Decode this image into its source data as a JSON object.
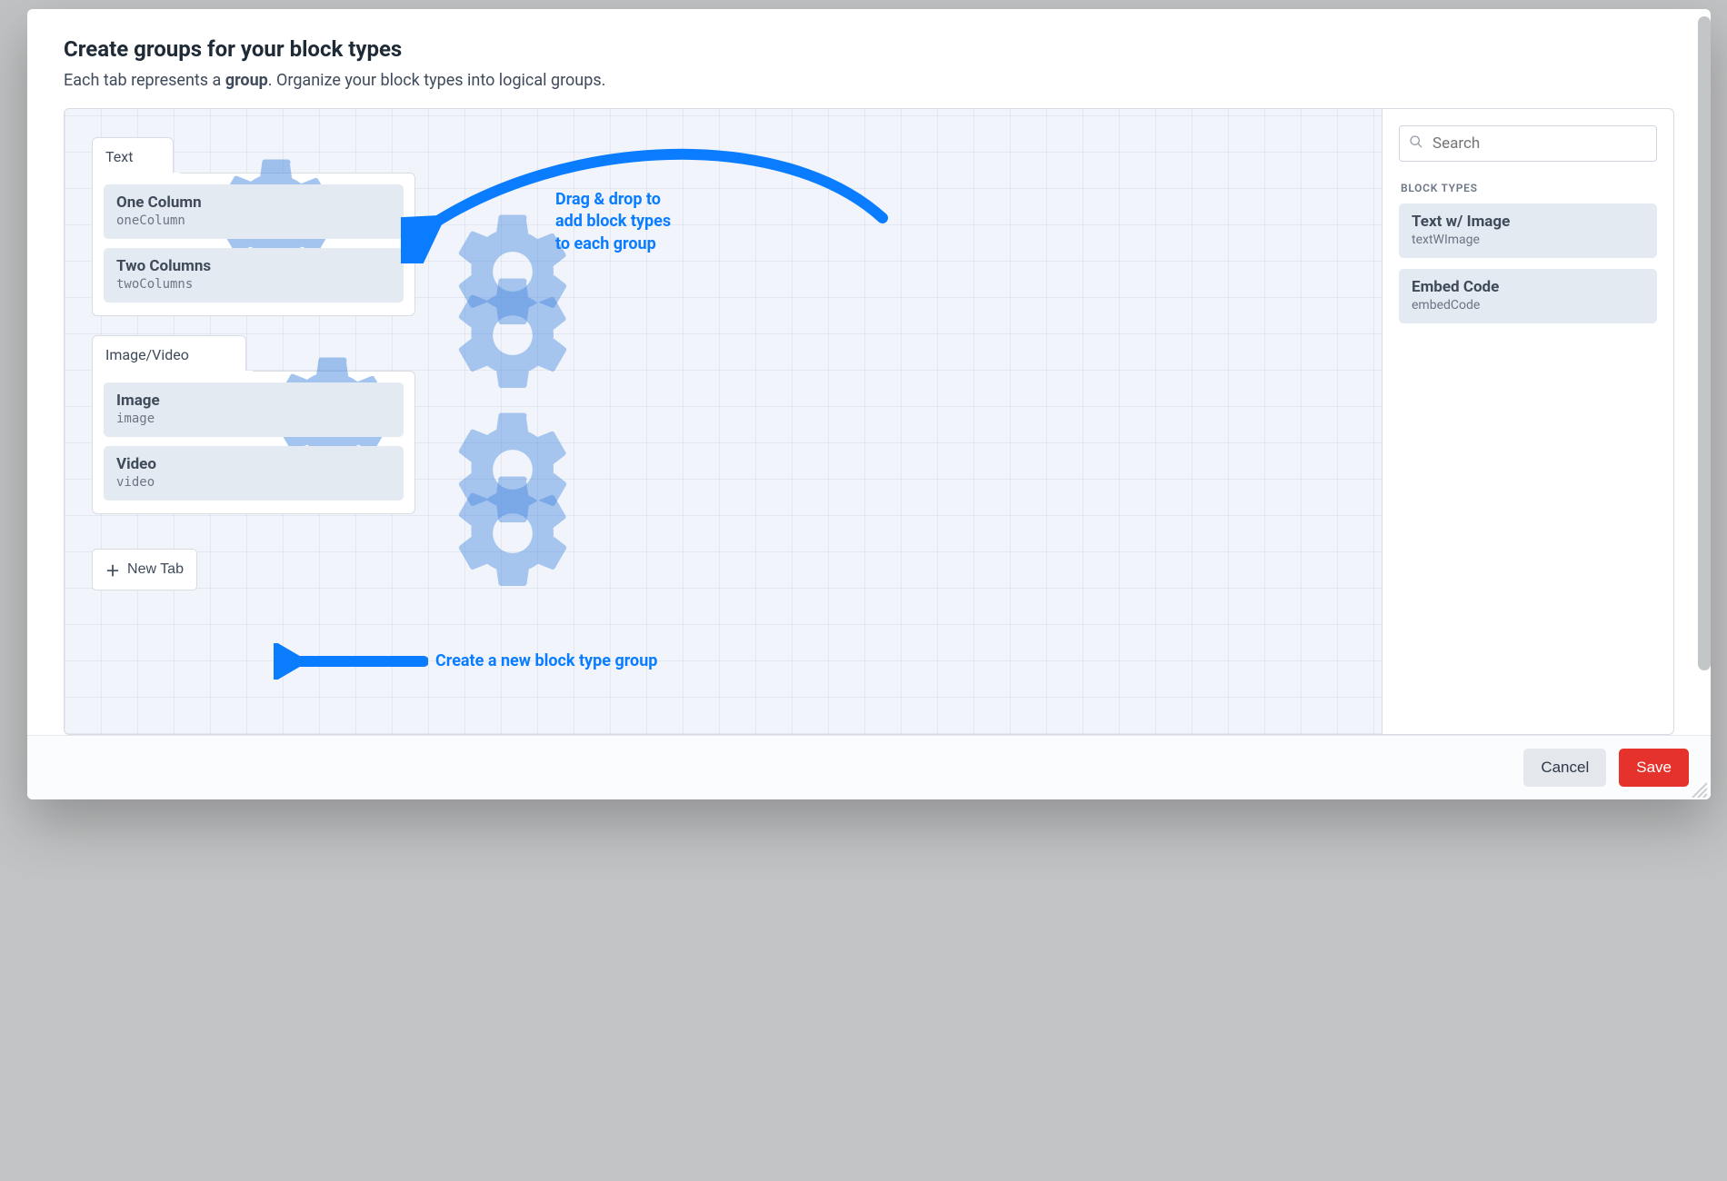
{
  "heading": {
    "title": "Create groups for your block types",
    "desc_before": "Each tab represents a ",
    "desc_bold": "group",
    "desc_after": ". Organize your block types into logical groups."
  },
  "groups": [
    {
      "tab": "Text",
      "items": [
        {
          "title": "One Column",
          "handle": "oneColumn"
        },
        {
          "title": "Two Columns",
          "handle": "twoColumns"
        }
      ]
    },
    {
      "tab": "Image/Video",
      "items": [
        {
          "title": "Image",
          "handle": "image"
        },
        {
          "title": "Video",
          "handle": "video"
        }
      ]
    }
  ],
  "newTab": "New Tab",
  "side": {
    "searchPlaceholder": "Search",
    "label": "BLOCK TYPES",
    "items": [
      {
        "title": "Text w/ Image",
        "handle": "textWImage"
      },
      {
        "title": "Embed Code",
        "handle": "embedCode"
      }
    ]
  },
  "annot": {
    "drag1": "Drag & drop to",
    "drag2": "add block types",
    "drag3": "to each group",
    "create": "Create a new block type group"
  },
  "footer": {
    "cancel": "Cancel",
    "save": "Save"
  }
}
